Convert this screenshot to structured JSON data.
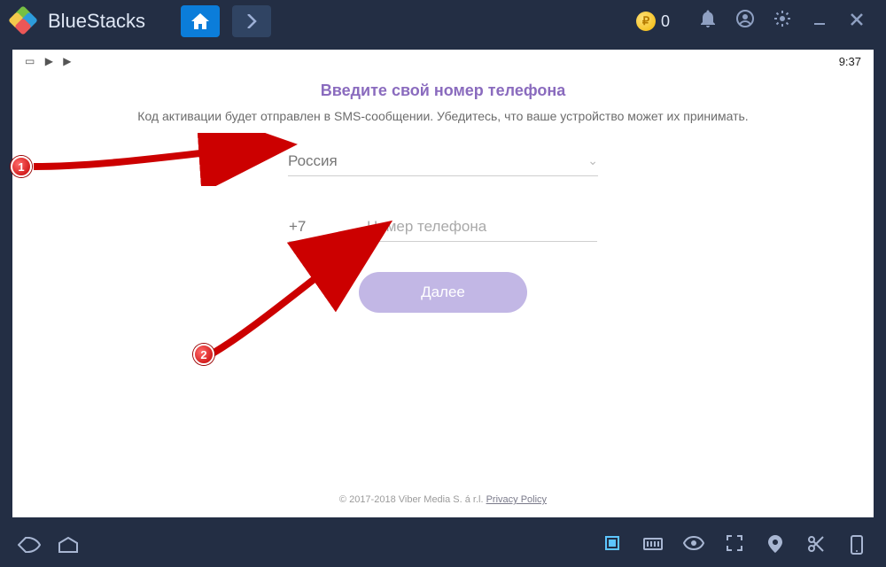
{
  "titlebar": {
    "brand": "BlueStacks",
    "coin_count": "0",
    "coin_symbol": "₽"
  },
  "statusbar": {
    "clock": "9:37"
  },
  "content": {
    "headline": "Введите свой номер телефона",
    "description": "Код активации будет отправлен в SMS-сообщении. Убедитесь, что ваше устройство может их принимать.",
    "country_selected": "Россия",
    "phone_prefix": "+7",
    "phone_placeholder": "Номер телефона",
    "next_label": "Далее"
  },
  "footer": {
    "copyright": "© 2017-2018 Viber Media S. á r.l. ",
    "privacy_label": "Privacy Policy"
  },
  "annotations": {
    "marker1": "1",
    "marker2": "2"
  }
}
